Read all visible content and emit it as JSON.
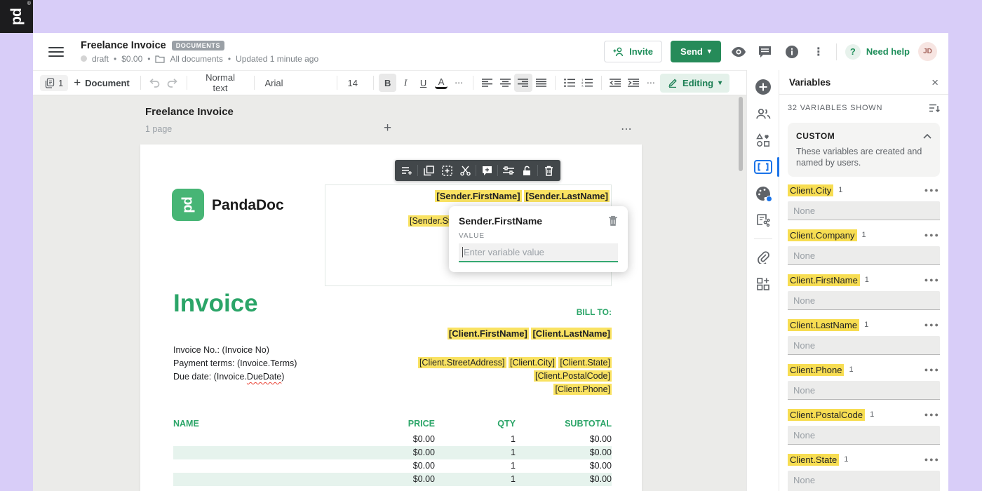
{
  "glyphs": {
    "plus": "+",
    "more_h": "⋯",
    "kebab_v": "⋮",
    "caret": "▾",
    "close": "×",
    "dot": "•",
    "registered": "®"
  },
  "topbar": {
    "logo_text": "pd"
  },
  "header": {
    "title": "Freelance Invoice",
    "badge": "DOCUMENTS",
    "status": "draft",
    "amount": "$0.00",
    "folder_label": "All documents",
    "updated": "Updated 1 minute ago",
    "invite_label": "Invite",
    "send_label": "Send",
    "help_q": "?",
    "need_help_label": "Need help",
    "avatar_initials": "JD"
  },
  "toolbar": {
    "page_count": "1",
    "document_label": "Document",
    "style_label": "Normal text",
    "font_label": "Arial",
    "size_label": "14",
    "bold": "B",
    "italic": "I",
    "underline": "U",
    "color": "A",
    "editing_label": "Editing"
  },
  "rail": {
    "icons": [
      "add-content",
      "contacts",
      "content-library",
      "variables",
      "design",
      "fields",
      "attachments",
      "integrations"
    ]
  },
  "canvas": {
    "doc_title": "Freelance Invoice",
    "pages_label": "1 page"
  },
  "document": {
    "brand": "PandaDoc",
    "block_toolbar_icons": [
      "add-row",
      "duplicate",
      "save-to-library",
      "cut",
      "add-comment",
      "properties",
      "unlock",
      "delete"
    ],
    "sender_chips": [
      "[Sender.FirstName]",
      "[Sender.LastName]"
    ],
    "sender_partial": "[Sender.St",
    "popup": {
      "title": "Sender.FirstName",
      "value_label": "VALUE",
      "input_placeholder": "Enter variable value"
    },
    "invoice_title": "Invoice",
    "bill_to": "BILL TO:",
    "client_chips": [
      "[Client.FirstName]",
      "[Client.LastName]"
    ],
    "meta_left": [
      "Invoice No.: (Invoice No)",
      "Payment terms: (Invoice.Terms)"
    ],
    "due": {
      "prefix": "Due date: (Invoice.",
      "word": "DueDate",
      "suffix": ")"
    },
    "address_line1": [
      "[Client.StreetAddress]",
      "[Client.City]",
      "[Client.State]"
    ],
    "address_line2": "[Client.PostalCode]",
    "address_line3": "[Client.Phone]",
    "table": {
      "headers": [
        "NAME",
        "PRICE",
        "QTY",
        "SUBTOTAL"
      ],
      "rows": [
        {
          "name": "",
          "price": "$0.00",
          "qty": "1",
          "subtotal": "$0.00"
        },
        {
          "name": "",
          "price": "$0.00",
          "qty": "1",
          "subtotal": "$0.00"
        },
        {
          "name": "",
          "price": "$0.00",
          "qty": "1",
          "subtotal": "$0.00"
        },
        {
          "name": "",
          "price": "$0.00",
          "qty": "1",
          "subtotal": "$0.00"
        }
      ]
    }
  },
  "variables_panel": {
    "title": "Variables",
    "count_label": "32 VARIABLES SHOWN",
    "section_title": "CUSTOM",
    "section_desc": "These variables are created and named by users.",
    "items": [
      {
        "name": "Client.City",
        "count": "1",
        "value": "None"
      },
      {
        "name": "Client.Company",
        "count": "1",
        "value": "None"
      },
      {
        "name": "Client.FirstName",
        "count": "1",
        "value": "None"
      },
      {
        "name": "Client.LastName",
        "count": "1",
        "value": "None"
      },
      {
        "name": "Client.Phone",
        "count": "1",
        "value": "None"
      },
      {
        "name": "Client.PostalCode",
        "count": "1",
        "value": "None"
      },
      {
        "name": "Client.State",
        "count": "1",
        "value": "None"
      }
    ]
  },
  "colors": {
    "topbar_purple": "#d8cdf8",
    "brand_green": "#47b575",
    "send_green": "#268b59",
    "doc_green": "#2ba568",
    "highlight_yellow": "#f9e262",
    "active_blue": "#1a73e8"
  }
}
